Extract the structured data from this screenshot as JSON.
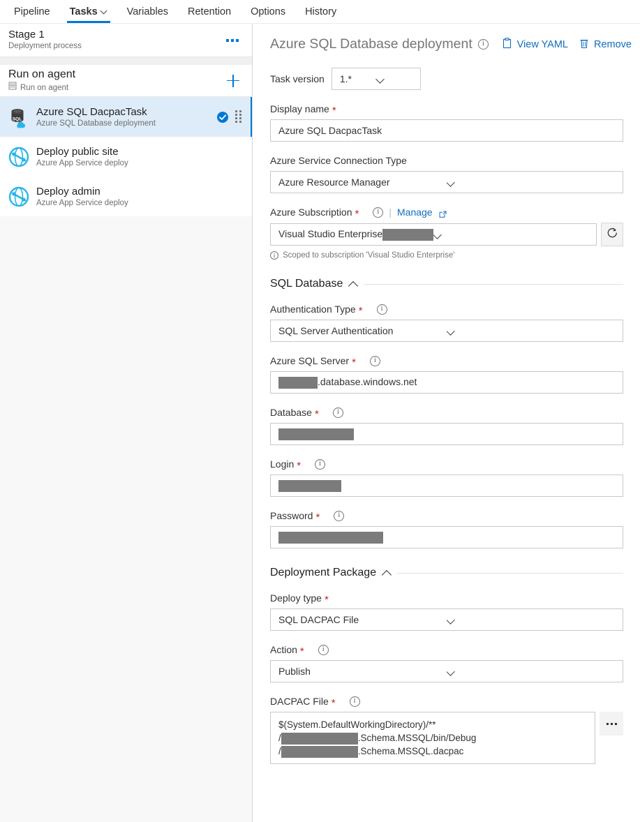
{
  "tabs": [
    {
      "label": "Pipeline",
      "active": false,
      "caret": false
    },
    {
      "label": "Tasks",
      "active": true,
      "caret": true
    },
    {
      "label": "Variables",
      "active": false,
      "caret": false
    },
    {
      "label": "Retention",
      "active": false,
      "caret": false
    },
    {
      "label": "Options",
      "active": false,
      "caret": false
    },
    {
      "label": "History",
      "active": false,
      "caret": false
    }
  ],
  "sidebar": {
    "stage": {
      "title": "Stage 1",
      "subtitle": "Deployment process",
      "more_label": "..."
    },
    "phase": {
      "title": "Run on agent",
      "subtitle": "Run on agent",
      "add_label": "+"
    },
    "tasks": [
      {
        "name": "Azure SQL DacpacTask",
        "description": "Azure SQL Database deployment",
        "icon": "azure-sql-database-icon",
        "selected": true,
        "enabled": true
      },
      {
        "name": "Deploy public site",
        "description": "Azure App Service deploy",
        "icon": "azure-app-service-icon",
        "selected": false,
        "enabled": false
      },
      {
        "name": "Deploy admin",
        "description": "Azure App Service deploy",
        "icon": "azure-app-service-icon",
        "selected": false,
        "enabled": false
      }
    ]
  },
  "detail": {
    "title": "Azure SQL Database deployment",
    "actions": {
      "view_yaml": "View YAML",
      "remove": "Remove"
    },
    "task_version": {
      "label": "Task version",
      "value": "1.*"
    },
    "display_name": {
      "label": "Display name",
      "required": "*",
      "value": "Azure SQL DacpacTask"
    },
    "connection_type": {
      "label": "Azure Service Connection Type",
      "value": "Azure Resource Manager"
    },
    "subscription": {
      "label": "Azure Subscription",
      "required": "*",
      "manage_label": "Manage",
      "value": "Visual Studio Enterprise",
      "note": "Scoped to subscription 'Visual Studio Enterprise'"
    },
    "sections": {
      "sql_database": "SQL Database",
      "deployment_package": "Deployment Package"
    },
    "auth_type": {
      "label": "Authentication Type",
      "required": "*",
      "value": "SQL Server Authentication"
    },
    "sql_server": {
      "label": "Azure SQL Server",
      "required": "*",
      "value_suffix": ".database.windows.net"
    },
    "database": {
      "label": "Database",
      "required": "*",
      "value": ""
    },
    "login": {
      "label": "Login",
      "required": "*",
      "value": ""
    },
    "password": {
      "label": "Password",
      "required": "*",
      "value": ""
    },
    "deploy_type": {
      "label": "Deploy type",
      "required": "*",
      "value": "SQL DACPAC File"
    },
    "action": {
      "label": "Action",
      "required": "*",
      "value": "Publish"
    },
    "dacpac_file": {
      "label": "DACPAC File",
      "required": "*",
      "line1": "$(System.DefaultWorkingDirectory)/**",
      "line2_prefix": "/",
      "line2_suffix": ".Schema.MSSQL/bin/Debug",
      "line3_prefix": "/",
      "line3_suffix": ".Schema.MSSQL.dacpac",
      "browse_label": "..."
    }
  },
  "colors": {
    "accent": "#0078d4",
    "link": "#106ebe",
    "selected_row": "#deecf9",
    "required": "#c6242a",
    "redaction": "#7b7b7b"
  }
}
